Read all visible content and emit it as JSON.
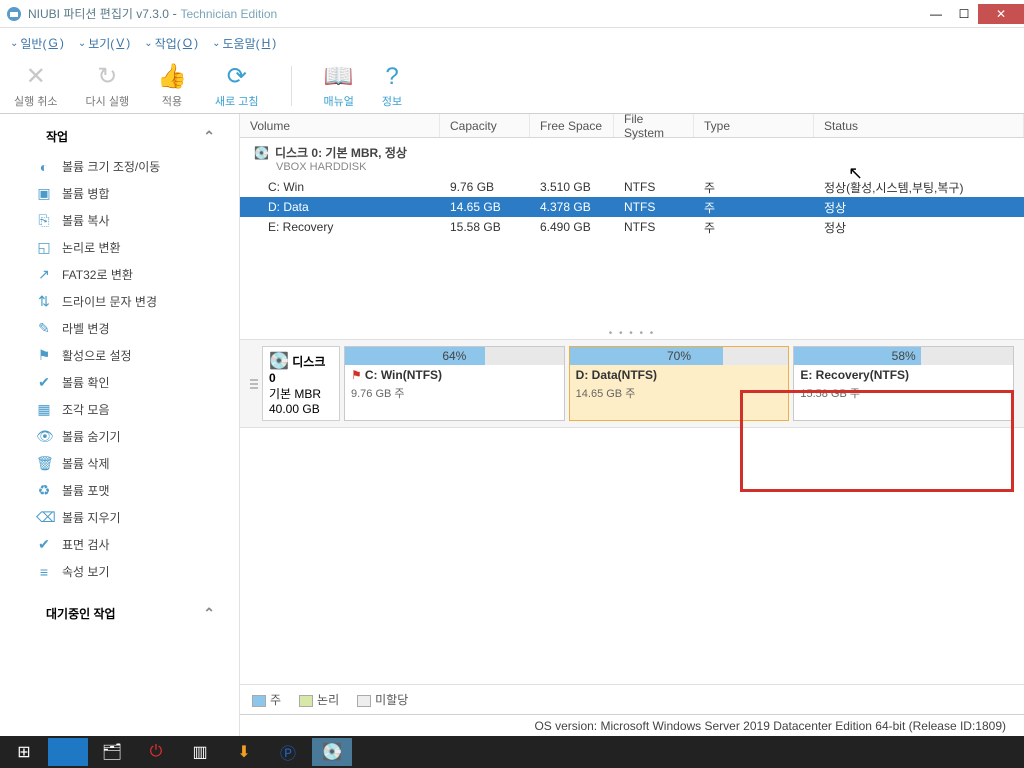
{
  "title": {
    "app": "NIUBI 파티션 편집기 v7.3.0",
    "edition": "Technician Edition"
  },
  "menu": [
    {
      "label": "일반",
      "accel": "G"
    },
    {
      "label": "보기",
      "accel": "V"
    },
    {
      "label": "작업",
      "accel": "O"
    },
    {
      "label": "도움말",
      "accel": "H"
    }
  ],
  "toolbar": [
    {
      "label": "실행 취소",
      "icon": "✕",
      "active": false
    },
    {
      "label": "다시 실행",
      "icon": "↻",
      "active": false
    },
    {
      "label": "적용",
      "icon": "👍",
      "active": false
    },
    {
      "label": "새로 고침",
      "icon": "⟳",
      "active": true
    },
    {
      "sep": true
    },
    {
      "label": "매뉴얼",
      "icon": "📖",
      "active": true
    },
    {
      "label": "정보",
      "icon": "?",
      "active": true
    }
  ],
  "sidebar": {
    "ops_header": "작업",
    "pending_header": "대기중인 작업",
    "items": [
      {
        "icon": "◐",
        "label": "볼륨 크기 조정/이동"
      },
      {
        "icon": "▣",
        "label": "볼륨 병합"
      },
      {
        "icon": "⎘",
        "label": "볼륨 복사"
      },
      {
        "icon": "◱",
        "label": "논리로 변환"
      },
      {
        "icon": "↗",
        "label": "FAT32로 변환"
      },
      {
        "icon": "⇅",
        "label": "드라이브 문자 변경"
      },
      {
        "icon": "✎",
        "label": "라벨 변경"
      },
      {
        "icon": "⚑",
        "label": "활성으로 설정"
      },
      {
        "icon": "✔",
        "label": "볼륨 확인"
      },
      {
        "icon": "▦",
        "label": "조각 모음"
      },
      {
        "icon": "👁",
        "label": "볼륨 숨기기"
      },
      {
        "icon": "🗑",
        "label": "볼륨 삭제"
      },
      {
        "icon": "♻",
        "label": "볼륨 포맷"
      },
      {
        "icon": "⌫",
        "label": "볼륨 지우기"
      },
      {
        "icon": "✔",
        "label": "표면 검사"
      },
      {
        "icon": "≡",
        "label": "속성 보기"
      }
    ]
  },
  "columns": {
    "volume": "Volume",
    "capacity": "Capacity",
    "free": "Free Space",
    "fs": "File System",
    "type": "Type",
    "status": "Status"
  },
  "disk_group": {
    "title": "디스크 0: 기본 MBR, 정상",
    "model": "VBOX HARDDISK"
  },
  "rows": [
    {
      "vol": "C: Win",
      "cap": "9.76 GB",
      "free": "3.510 GB",
      "fs": "NTFS",
      "type": "주",
      "status": "정상(활성,시스템,부팅,복구)",
      "selected": false
    },
    {
      "vol": "D: Data",
      "cap": "14.65 GB",
      "free": "4.378 GB",
      "fs": "NTFS",
      "type": "주",
      "status": "정상",
      "selected": true
    },
    {
      "vol": "E: Recovery",
      "cap": "15.58 GB",
      "free": "6.490 GB",
      "fs": "NTFS",
      "type": "주",
      "status": "정상",
      "selected": false
    }
  ],
  "diskmap": {
    "disk_label": "디스크 0",
    "disk_type": "기본 MBR",
    "disk_size": "40.00 GB",
    "parts": [
      {
        "pct": "64%",
        "fill": 64,
        "name": "C: Win(NTFS)",
        "sub": "9.76 GB 주",
        "flag": true
      },
      {
        "pct": "70%",
        "fill": 70,
        "name": "D: Data(NTFS)",
        "sub": "14.65 GB 주",
        "selected": true
      },
      {
        "pct": "58%",
        "fill": 58,
        "name": "E: Recovery(NTFS)",
        "sub": "15.58 GB 주"
      }
    ]
  },
  "legend": {
    "primary": "주",
    "logical": "논리",
    "unalloc": "미할당"
  },
  "statusbar": "OS version: Microsoft Windows Server 2019 Datacenter Edition  64-bit  (Release ID:1809)"
}
